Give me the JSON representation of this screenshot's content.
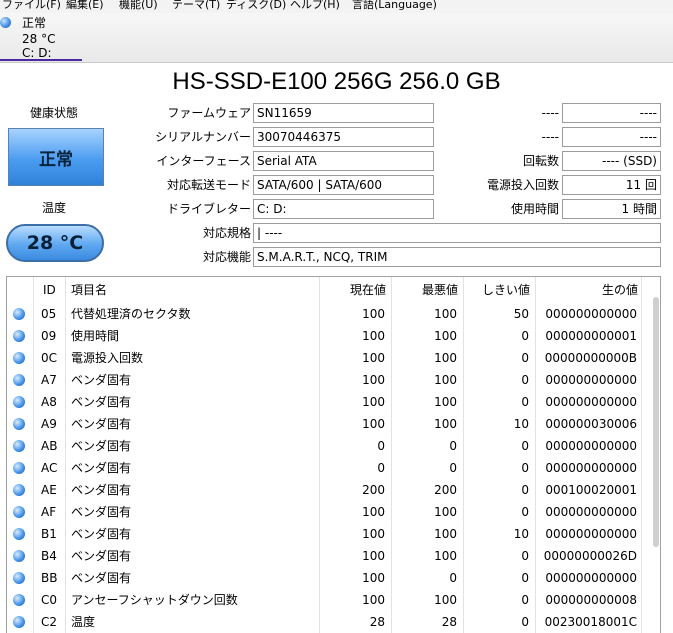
{
  "menu": [
    "ファイル(F)",
    "編集(E)",
    "機能(U)",
    "テーマ(T)",
    "ディスク(D)",
    "ヘルプ(H)",
    "言語(Language)"
  ],
  "disk_tab": {
    "status": "正常",
    "temp": "28 °C",
    "drives": "C: D:"
  },
  "title": "HS-SSD-E100 256G 256.0 GB",
  "health": {
    "label": "健康状態",
    "value": "正常"
  },
  "temperature": {
    "label": "温度",
    "value": "28 °C"
  },
  "info": {
    "firmware_label": "ファームウェア",
    "firmware": "SN11659",
    "serial_label": "シリアルナンバー",
    "serial": "30070446375",
    "interface_label": "インターフェース",
    "interface": "Serial ATA",
    "transfer_label": "対応転送モード",
    "transfer": "SATA/600 | SATA/600",
    "drive_letter_label": "ドライブレター",
    "drive_letter": "C: D:",
    "standard_label": "対応規格",
    "standard": " | ----",
    "features_label": "対応機能",
    "features": "S.M.A.R.T., NCQ, TRIM",
    "blank1_label": "----",
    "blank1": "----",
    "blank2_label": "----",
    "blank2": "----",
    "rpm_label": "回転数",
    "rpm": "---- (SSD)",
    "power_count_label": "電源投入回数",
    "power_count": "11 回",
    "power_hours_label": "使用時間",
    "power_hours": "1 時間"
  },
  "table": {
    "headers": {
      "id": "ID",
      "name": "項目名",
      "current": "現在値",
      "worst": "最悪値",
      "threshold": "しきい値",
      "raw": "生の値"
    },
    "rows": [
      {
        "id": "05",
        "name": "代替処理済のセクタ数",
        "current": "100",
        "worst": "100",
        "threshold": "50",
        "raw": "000000000000"
      },
      {
        "id": "09",
        "name": "使用時間",
        "current": "100",
        "worst": "100",
        "threshold": "0",
        "raw": "000000000001"
      },
      {
        "id": "0C",
        "name": "電源投入回数",
        "current": "100",
        "worst": "100",
        "threshold": "0",
        "raw": "00000000000B"
      },
      {
        "id": "A7",
        "name": "ベンダ固有",
        "current": "100",
        "worst": "100",
        "threshold": "0",
        "raw": "000000000000"
      },
      {
        "id": "A8",
        "name": "ベンダ固有",
        "current": "100",
        "worst": "100",
        "threshold": "0",
        "raw": "000000000000"
      },
      {
        "id": "A9",
        "name": "ベンダ固有",
        "current": "100",
        "worst": "100",
        "threshold": "10",
        "raw": "000000030006"
      },
      {
        "id": "AB",
        "name": "ベンダ固有",
        "current": "0",
        "worst": "0",
        "threshold": "0",
        "raw": "000000000000"
      },
      {
        "id": "AC",
        "name": "ベンダ固有",
        "current": "0",
        "worst": "0",
        "threshold": "0",
        "raw": "000000000000"
      },
      {
        "id": "AE",
        "name": "ベンダ固有",
        "current": "200",
        "worst": "200",
        "threshold": "0",
        "raw": "000100020001"
      },
      {
        "id": "AF",
        "name": "ベンダ固有",
        "current": "100",
        "worst": "100",
        "threshold": "0",
        "raw": "000000000000"
      },
      {
        "id": "B1",
        "name": "ベンダ固有",
        "current": "100",
        "worst": "100",
        "threshold": "10",
        "raw": "000000000000"
      },
      {
        "id": "B4",
        "name": "ベンダ固有",
        "current": "100",
        "worst": "100",
        "threshold": "0",
        "raw": "00000000026D"
      },
      {
        "id": "BB",
        "name": "ベンダ固有",
        "current": "100",
        "worst": "0",
        "threshold": "0",
        "raw": "000000000000"
      },
      {
        "id": "C0",
        "name": "アンセーフシャットダウン回数",
        "current": "100",
        "worst": "100",
        "threshold": "0",
        "raw": "000000000008"
      },
      {
        "id": "C2",
        "name": "温度",
        "current": "28",
        "worst": "28",
        "threshold": "0",
        "raw": "00230018001C"
      }
    ]
  }
}
